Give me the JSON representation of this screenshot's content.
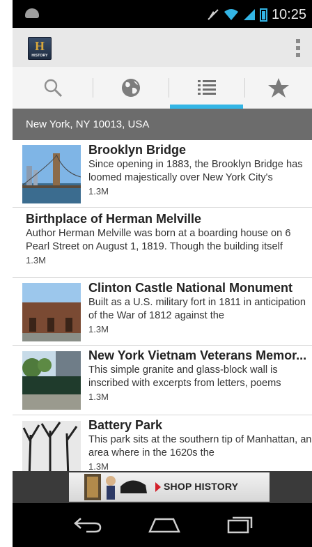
{
  "status_bar": {
    "time": "10:25",
    "icons": [
      "android-icon",
      "mute-icon",
      "wifi-icon",
      "signal-icon",
      "battery-icon"
    ]
  },
  "action_bar": {
    "logo_text": "H",
    "logo_subtext": "HISTORY",
    "overflow_icon": "overflow-menu-icon"
  },
  "tabs": [
    {
      "icon": "search-icon",
      "selected": false
    },
    {
      "icon": "globe-icon",
      "selected": false
    },
    {
      "icon": "list-icon",
      "selected": true
    },
    {
      "icon": "star-icon",
      "selected": false
    }
  ],
  "location": "New York, NY 10013, USA",
  "places": [
    {
      "title": "Brooklyn Bridge",
      "description": "Since opening in 1883, the Brooklyn Bridge has loomed majestically over New York City's",
      "distance": "1.3M",
      "has_image": true
    },
    {
      "title": "Birthplace of Herman Melville",
      "description": "Author Herman Melville was born at a boarding house on 6 Pearl Street on August 1, 1819. Though the building itself",
      "distance": "1.3M",
      "has_image": false
    },
    {
      "title": "Clinton Castle National Monument",
      "description": "Built as a U.S. military fort in 1811 in anticipation of the War of 1812 against the",
      "distance": "1.3M",
      "has_image": true
    },
    {
      "title": "New York Vietnam Veterans Memor...",
      "description": "This simple granite and glass-block wall is inscribed with excerpts from letters, poems",
      "distance": "1.3M",
      "has_image": true
    },
    {
      "title": "Battery Park",
      "description": "This park sits at the southern tip of Manhattan, an area where in the 1620s the",
      "distance": "1.3M",
      "has_image": true
    }
  ],
  "ad": {
    "text": "SHOP HISTORY"
  },
  "nav_bar": [
    "back-icon",
    "home-icon",
    "recent-apps-icon"
  ],
  "colors": {
    "accent": "#33b5e5",
    "location_bar": "#6c6c6c",
    "ad_arrow": "#d3202a"
  }
}
